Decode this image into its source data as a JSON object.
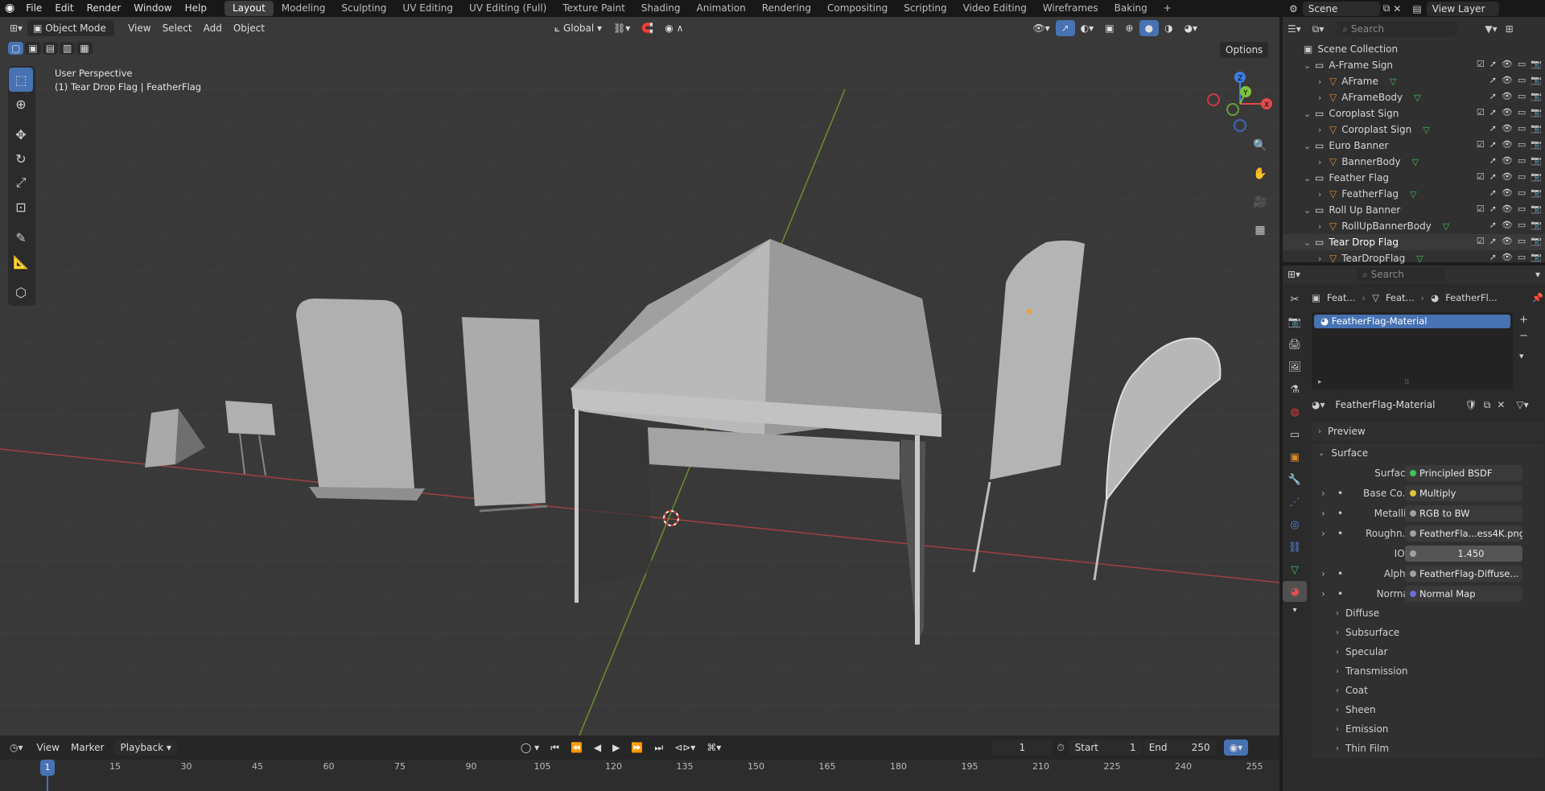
{
  "topbar": {
    "menus": [
      "File",
      "Edit",
      "Render",
      "Window",
      "Help"
    ],
    "workspaces": [
      "Layout",
      "Modeling",
      "Sculpting",
      "UV Editing",
      "UV Editing (Full)",
      "Texture Paint",
      "Shading",
      "Animation",
      "Rendering",
      "Compositing",
      "Scripting",
      "Video Editing",
      "Wireframes",
      "Baking"
    ],
    "active_workspace": "Layout",
    "scene": "Scene",
    "view_layer": "View Layer"
  },
  "viewport": {
    "mode": "Object Mode",
    "menus": [
      "View",
      "Select",
      "Add",
      "Object"
    ],
    "orientation": "Global",
    "options": "Options",
    "info_line1": "User Perspective",
    "info_line2": "(1) Tear Drop Flag | FeatherFlag",
    "gizmo": {
      "x": "X",
      "y": "Y",
      "z": "Z"
    }
  },
  "timeline": {
    "menus": [
      "View",
      "Marker",
      "Playback"
    ],
    "current_frame": "1",
    "start_label": "Start",
    "start": "1",
    "end_label": "End",
    "end": "250",
    "ticks": [
      "15",
      "30",
      "45",
      "60",
      "75",
      "90",
      "105",
      "120",
      "135",
      "150",
      "165",
      "180",
      "195",
      "210",
      "225",
      "240",
      "255"
    ],
    "playhead": "1"
  },
  "outliner": {
    "search_placeholder": "Search",
    "root": "Scene Collection",
    "rows": [
      {
        "name": "A-Frame Sign",
        "kind": "collection",
        "depth": 1
      },
      {
        "name": "AFrame",
        "kind": "object",
        "depth": 2
      },
      {
        "name": "AFrameBody",
        "kind": "object",
        "depth": 2
      },
      {
        "name": "Coroplast Sign",
        "kind": "collection",
        "depth": 1
      },
      {
        "name": "Coroplast Sign",
        "kind": "object",
        "depth": 2
      },
      {
        "name": "Euro Banner",
        "kind": "collection",
        "depth": 1
      },
      {
        "name": "BannerBody",
        "kind": "object",
        "depth": 2
      },
      {
        "name": "Feather Flag",
        "kind": "collection",
        "depth": 1
      },
      {
        "name": "FeatherFlag",
        "kind": "object",
        "depth": 2
      },
      {
        "name": "Roll Up Banner",
        "kind": "collection",
        "depth": 1
      },
      {
        "name": "RollUpBannerBody",
        "kind": "object",
        "depth": 2
      },
      {
        "name": "Tear Drop Flag",
        "kind": "collection",
        "depth": 1
      },
      {
        "name": "TearDropFlag",
        "kind": "object",
        "depth": 2
      }
    ]
  },
  "properties": {
    "search_placeholder": "Search",
    "breadcrumb": [
      "Feat...",
      "Feat...",
      "FeatherFl..."
    ],
    "material_slot": "FeatherFlag-Material",
    "material_name": "FeatherFlag-Material",
    "sections": {
      "preview": "Preview",
      "surface": "Surface"
    },
    "surface_rows": [
      {
        "label": "Surface",
        "value": "Principled BSDF",
        "color": "#3ec45a",
        "expand": false
      },
      {
        "label": "Base Co...",
        "value": "Multiply",
        "color": "#e0c43a",
        "expand": true
      },
      {
        "label": "Metallic",
        "value": "RGB to BW",
        "color": "#a0a0a0",
        "expand": true
      },
      {
        "label": "Roughn...",
        "value": "FeatherFla...ess4K.png",
        "color": "#a0a0a0",
        "expand": true
      },
      {
        "label": "IOR",
        "value": "1.450",
        "color": "#a0a0a0",
        "expand": false
      },
      {
        "label": "Alpha",
        "value": "FeatherFlag-Diffuse...",
        "color": "#a0a0a0",
        "expand": true
      },
      {
        "label": "Normal",
        "value": "Normal Map",
        "color": "#6c6cd6",
        "expand": true
      }
    ],
    "subpanels": [
      "Diffuse",
      "Subsurface",
      "Specular",
      "Transmission",
      "Coat",
      "Sheen",
      "Emission",
      "Thin Film"
    ]
  }
}
